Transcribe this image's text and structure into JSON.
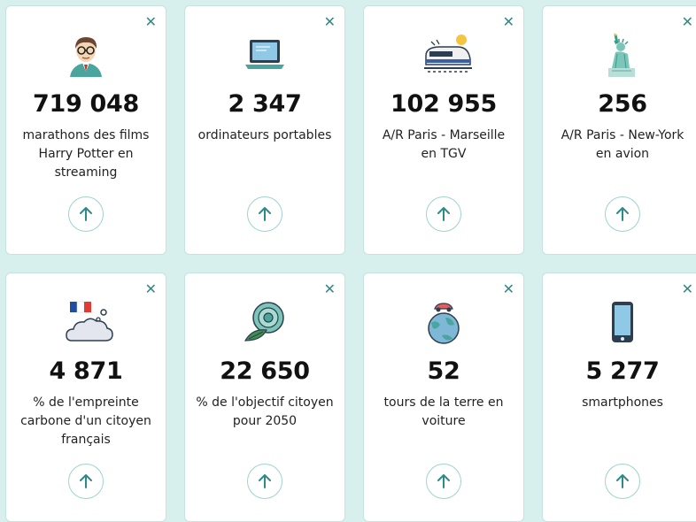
{
  "cards": [
    {
      "value": "719 048",
      "label": "marathons des films Harry Potter en streaming",
      "icon": "harry-potter-icon"
    },
    {
      "value": "2 347",
      "label": "ordinateurs portables",
      "icon": "laptop-icon"
    },
    {
      "value": "102 955",
      "label": "A/R Paris - Marseille en TGV",
      "icon": "tgv-train-icon"
    },
    {
      "value": "256",
      "label": "A/R Paris - New-York en avion",
      "icon": "statue-of-liberty-icon"
    },
    {
      "value": "4 871",
      "label": "% de l'empreinte carbone d'un citoyen français",
      "icon": "french-cloud-icon"
    },
    {
      "value": "22 650",
      "label": "% de l'objectif citoyen pour 2050",
      "icon": "target-leaf-icon"
    },
    {
      "value": "52",
      "label": "tours de la terre en voiture",
      "icon": "earth-car-icon"
    },
    {
      "value": "5 277",
      "label": "smartphones",
      "icon": "smartphone-icon"
    }
  ],
  "close_symbol": "✕",
  "colors": {
    "accent": "#2e8a86",
    "background": "#d7efed",
    "card_border": "#c5e3e0"
  }
}
